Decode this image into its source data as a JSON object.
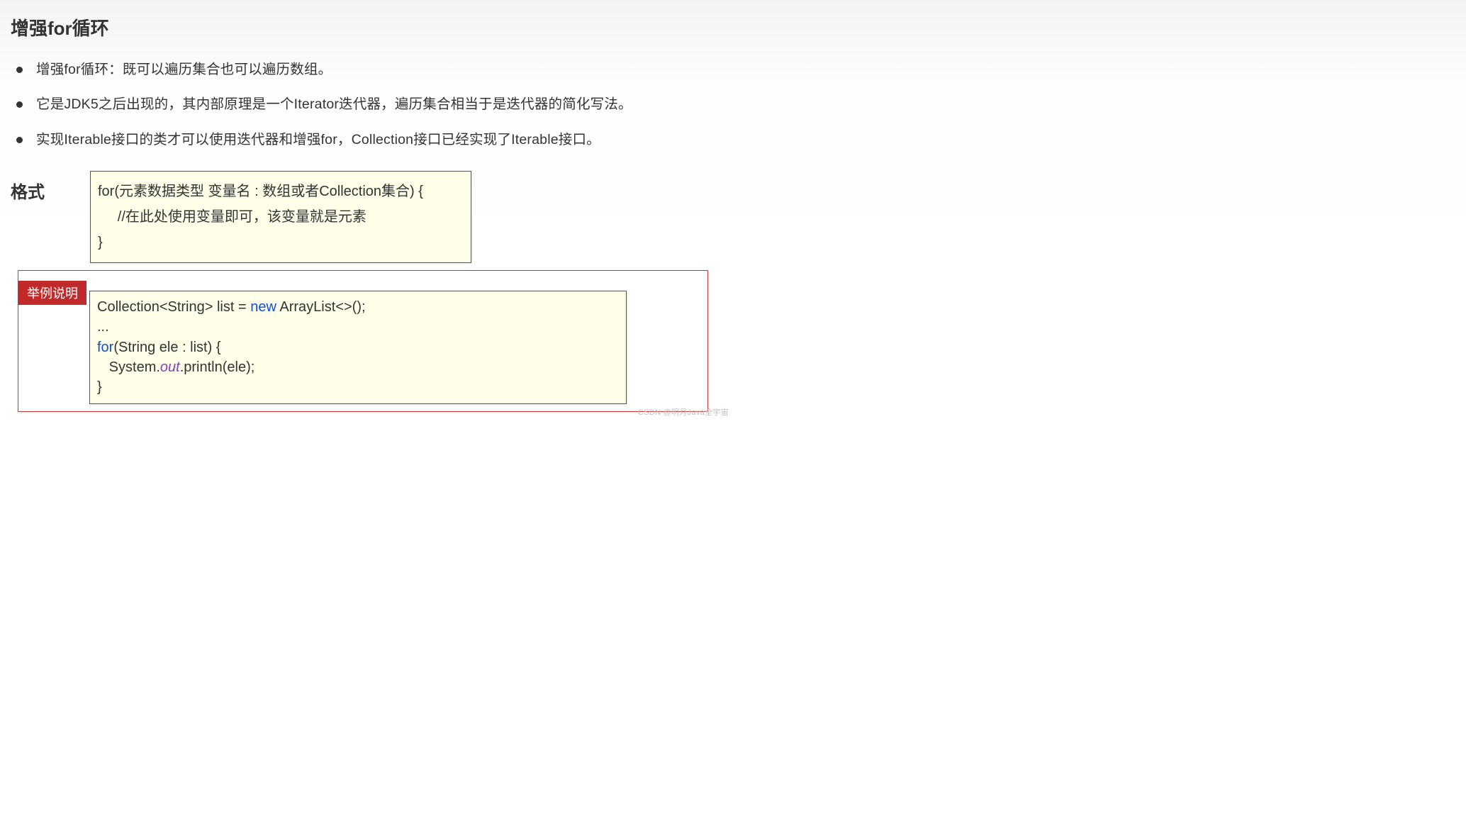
{
  "title": "增强for循环",
  "bullets": [
    "增强for循环：既可以遍历集合也可以遍历数组。",
    "它是JDK5之后出现的，其内部原理是一个Iterator迭代器，遍历集合相当于是迭代器的简化写法。",
    "实现Iterable接口的类才可以使用迭代器和增强for，Collection接口已经实现了Iterable接口。"
  ],
  "format": {
    "label": "格式",
    "line1": "for(元素数据类型 变量名 : 数组或者Collection集合) {",
    "line2": "     //在此处使用变量即可，该变量就是元素",
    "line3": "}"
  },
  "example": {
    "badge": "举例说明",
    "line1_a": "Collection<String> list = ",
    "line1_new": "new",
    "line1_b": " ArrayList<>();",
    "line2": "...",
    "line3_for": "for",
    "line3_b": "(String ele : list) {",
    "line4_a": "   System.",
    "line4_out": "out",
    "line4_b": ".println(ele);",
    "line5": "}"
  },
  "watermark": "CSDN @明月Java全宇宙"
}
